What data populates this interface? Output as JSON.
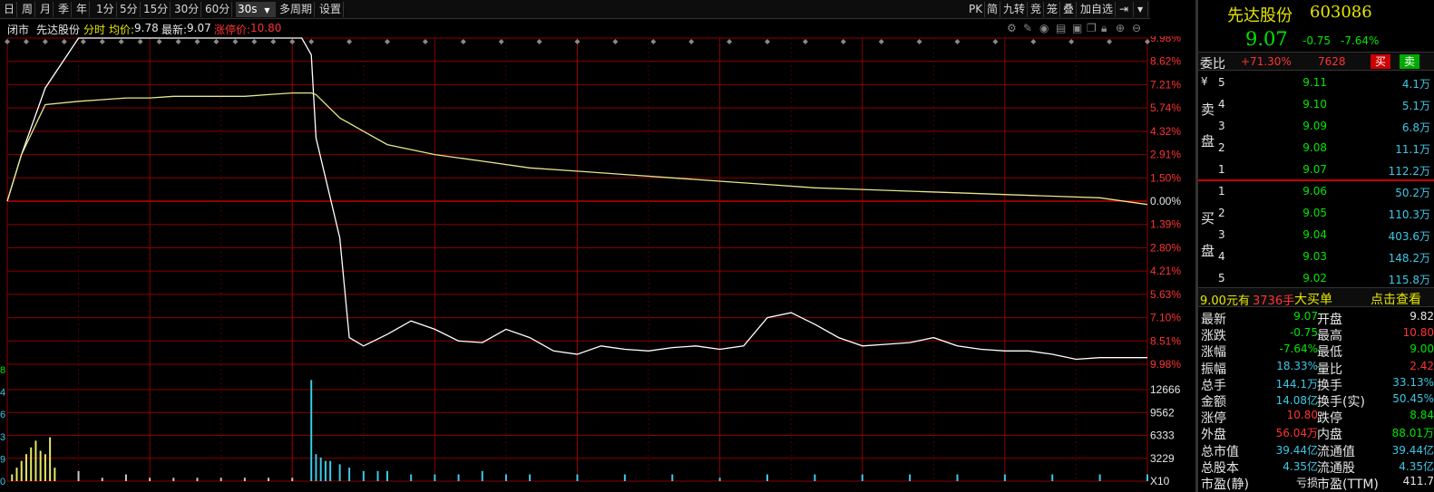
{
  "toolbar": {
    "periods": [
      "日",
      "周",
      "月",
      "季",
      "年",
      "1分",
      "5分",
      "15分",
      "30分",
      "60分",
      "30s",
      "多周期",
      "设置"
    ],
    "right_tools": [
      "PK",
      "简",
      "九转",
      "竞",
      "笼",
      "叠",
      "加自选"
    ]
  },
  "subheader": {
    "status": "闭市",
    "stock_name": "先达股份",
    "mode": "分时",
    "avg_label": "均价:",
    "avg_value": "9.78",
    "latest_label": "最新:",
    "latest_value": "9.07",
    "limit_label": "涨停价:",
    "limit_value": "10.80"
  },
  "colors": {
    "up": "#ff3232",
    "down": "#00e600",
    "grid": "#8b0000",
    "price_line": "#ffffff",
    "avg_line": "#e6e68c",
    "volume_up": "#c8c8c8",
    "volume_down": "#3cc8e6",
    "volume_early": "#e6e664"
  },
  "chart_data": {
    "type": "line",
    "price_axis": [
      "9.98%",
      "8.62%",
      "7.21%",
      "5.74%",
      "4.32%",
      "2.91%",
      "1.50%",
      "0.00%",
      "1.39%",
      "2.80%",
      "4.21%",
      "5.63%",
      "7.10%",
      "8.51%",
      "9.98%"
    ],
    "volume_axis": [
      "12666",
      "9562",
      "6333",
      "3229",
      "X10"
    ],
    "left_axis_fragments": [
      "8",
      "4",
      "6",
      "3",
      "9",
      "0"
    ],
    "prev_close": 9.82,
    "limit_up": 10.8,
    "series": [
      {
        "name": "price",
        "x": [
          0,
          3,
          8,
          15,
          20,
          25,
          28,
          30,
          35,
          40,
          45,
          50,
          55,
          60,
          62,
          64,
          65,
          70,
          72,
          75,
          80,
          85,
          90,
          95,
          100,
          105,
          110,
          115,
          120,
          125,
          130,
          135,
          140,
          145,
          150,
          155,
          160,
          165,
          170,
          175,
          180,
          185,
          190,
          195,
          200,
          205,
          210,
          215,
          220,
          225,
          230,
          235,
          240
        ],
        "y": [
          9.82,
          10.1,
          10.5,
          10.8,
          10.8,
          10.8,
          10.8,
          10.8,
          10.8,
          10.8,
          10.8,
          10.8,
          10.8,
          10.8,
          10.8,
          10.7,
          10.2,
          9.6,
          9.0,
          8.95,
          9.02,
          9.1,
          9.05,
          8.98,
          8.97,
          9.05,
          9.0,
          8.92,
          8.9,
          8.95,
          8.93,
          8.92,
          8.94,
          8.95,
          8.93,
          8.95,
          9.12,
          9.15,
          9.08,
          9.0,
          8.95,
          8.96,
          8.97,
          9.0,
          8.95,
          8.93,
          8.92,
          8.92,
          8.9,
          8.87,
          8.88,
          8.88,
          8.88
        ]
      },
      {
        "name": "avg",
        "x": [
          0,
          3,
          8,
          15,
          20,
          25,
          30,
          35,
          40,
          45,
          50,
          55,
          60,
          63,
          64,
          65,
          70,
          75,
          80,
          90,
          100,
          110,
          120,
          130,
          140,
          150,
          160,
          170,
          180,
          190,
          200,
          210,
          220,
          230,
          240
        ],
        "y": [
          9.82,
          10.1,
          10.4,
          10.42,
          10.43,
          10.44,
          10.44,
          10.45,
          10.45,
          10.45,
          10.45,
          10.46,
          10.47,
          10.47,
          10.47,
          10.46,
          10.32,
          10.24,
          10.16,
          10.1,
          10.06,
          10.02,
          10.0,
          9.98,
          9.96,
          9.94,
          9.92,
          9.9,
          9.89,
          9.88,
          9.87,
          9.86,
          9.85,
          9.84,
          9.8
        ]
      }
    ],
    "volume": {
      "x": [
        1,
        2,
        3,
        4,
        5,
        6,
        7,
        8,
        9,
        10,
        15,
        20,
        25,
        30,
        35,
        40,
        45,
        50,
        55,
        60,
        64,
        65,
        66,
        67,
        68,
        70,
        72,
        75,
        78,
        80,
        85,
        90,
        95,
        100,
        105,
        110,
        120,
        130,
        140,
        150,
        160,
        170,
        180,
        190,
        200,
        210,
        220,
        230,
        240
      ],
      "values": [
        2,
        4,
        6,
        8,
        10,
        12,
        9,
        8,
        13,
        4,
        3,
        1,
        2,
        1,
        1,
        1,
        1,
        1,
        1,
        1,
        30,
        8,
        7,
        6,
        6,
        5,
        4,
        3,
        3,
        3,
        2,
        2,
        2,
        3,
        2,
        2,
        2,
        2,
        2,
        1,
        2,
        2,
        2,
        2,
        2,
        2,
        2,
        2,
        2
      ]
    }
  },
  "quote": {
    "name": "先达股份",
    "code": "603086",
    "price": "9.07",
    "change": "-0.75",
    "change_pct": "-7.64%",
    "weibi_label": "委比",
    "weibi_value": "+71.30%",
    "weicha_value": "7628",
    "buy_btn": "买",
    "sell_btn": "卖",
    "sell_side_label": [
      "卖",
      "盘"
    ],
    "buy_side_label": [
      "买",
      "盘"
    ],
    "yen": "¥",
    "asks": [
      {
        "level": "5",
        "price": "9.11",
        "vol": "4.1万"
      },
      {
        "level": "4",
        "price": "9.10",
        "vol": "5.1万"
      },
      {
        "level": "3",
        "price": "9.09",
        "vol": "6.8万"
      },
      {
        "level": "2",
        "price": "9.08",
        "vol": "11.1万"
      },
      {
        "level": "1",
        "price": "9.07",
        "vol": "112.2万"
      }
    ],
    "bids": [
      {
        "level": "1",
        "price": "9.06",
        "vol": "50.2万"
      },
      {
        "level": "2",
        "price": "9.05",
        "vol": "110.3万"
      },
      {
        "level": "3",
        "price": "9.04",
        "vol": "403.6万"
      },
      {
        "level": "4",
        "price": "9.03",
        "vol": "148.2万"
      },
      {
        "level": "5",
        "price": "9.02",
        "vol": "115.8万"
      }
    ],
    "bigorder": {
      "price": "9.00元有",
      "qty": "3736手",
      "text": "大买单",
      "link": "点击查看"
    },
    "stats": [
      {
        "l1": "最新",
        "v1": "9.07",
        "c1": "green",
        "l2": "开盘",
        "v2": "9.82",
        "c2": "white"
      },
      {
        "l1": "涨跌",
        "v1": "-0.75",
        "c1": "green",
        "l2": "最高",
        "v2": "10.80",
        "c2": "red"
      },
      {
        "l1": "涨幅",
        "v1": "-7.64%",
        "c1": "green",
        "l2": "最低",
        "v2": "9.00",
        "c2": "green"
      },
      {
        "l1": "振幅",
        "v1": "18.33%",
        "c1": "cyan",
        "l2": "量比",
        "v2": "2.42",
        "c2": "red"
      },
      {
        "l1": "总手",
        "v1": "144.1万",
        "c1": "cyan",
        "l2": "换手",
        "v2": "33.13%",
        "c2": "cyan"
      },
      {
        "l1": "金额",
        "v1": "14.08亿",
        "c1": "cyan",
        "l2": "换手(实)",
        "v2": "50.45%",
        "c2": "cyan"
      },
      {
        "l1": "涨停",
        "v1": "10.80",
        "c1": "red",
        "l2": "跌停",
        "v2": "8.84",
        "c2": "green"
      },
      {
        "l1": "外盘",
        "v1": "56.04万",
        "c1": "red",
        "l2": "内盘",
        "v2": "88.01万",
        "c2": "green"
      },
      {
        "l1": "总市值",
        "v1": "39.44亿",
        "c1": "cyan",
        "l2": "流通值",
        "v2": "39.44亿",
        "c2": "cyan"
      },
      {
        "l1": "总股本",
        "v1": "4.35亿",
        "c1": "cyan",
        "l2": "流通股",
        "v2": "4.35亿",
        "c2": "cyan"
      },
      {
        "l1": "市盈(静)",
        "v1": "亏损",
        "c1": "white",
        "l2": "市盈(TTM)",
        "v2": "411.7",
        "c2": "white"
      }
    ]
  }
}
